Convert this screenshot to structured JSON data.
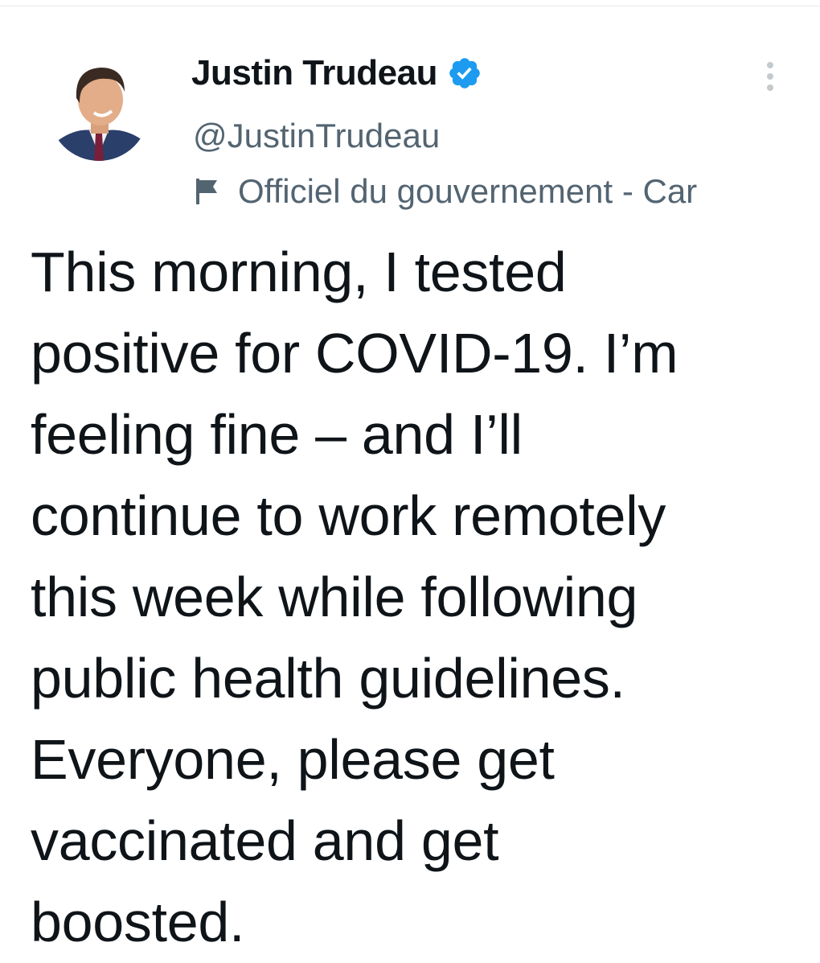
{
  "tweet": {
    "author": {
      "display_name": "Justin Trudeau",
      "handle": "@JustinTrudeau",
      "verified": true,
      "label": "Officiel du gouvernement - Car"
    },
    "text_lines": [
      "This morning, I tested",
      "positive for COVID-19. I’m",
      "feeling fine – and I’ll",
      "continue to work remotely",
      "this week while following",
      "public health guidelines.",
      "Everyone, please get",
      "vaccinated and get",
      "boosted."
    ]
  },
  "colors": {
    "text_primary": "#0f1419",
    "text_secondary": "#536471",
    "verified_blue": "#1d9bf0",
    "divider": "#e6e8ea"
  },
  "icons": {
    "verified": "verified-badge-icon",
    "label": "flag-icon",
    "menu": "more-vertical-icon"
  }
}
